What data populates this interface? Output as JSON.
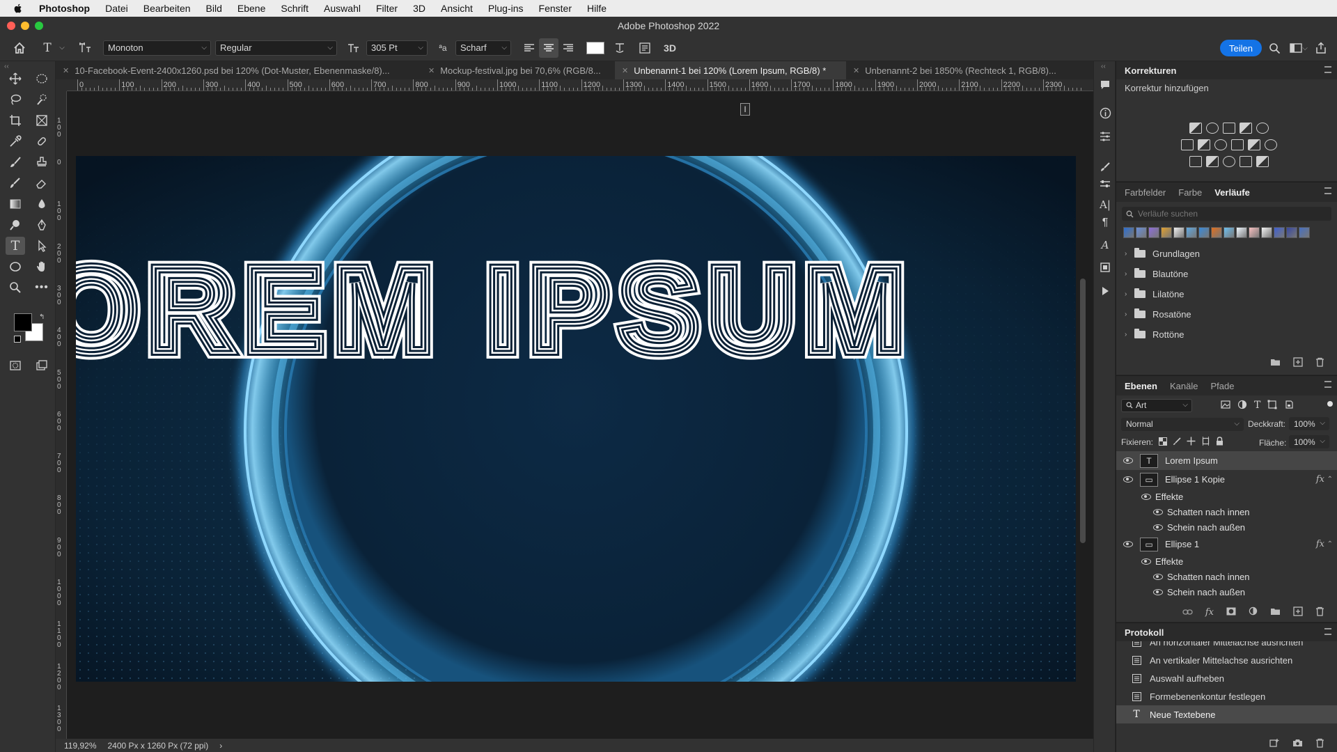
{
  "menubar": {
    "app": "Photoshop",
    "items": [
      "Datei",
      "Bearbeiten",
      "Bild",
      "Ebene",
      "Schrift",
      "Auswahl",
      "Filter",
      "3D",
      "Ansicht",
      "Plug-ins",
      "Fenster",
      "Hilfe"
    ]
  },
  "window": {
    "title": "Adobe Photoshop 2022"
  },
  "options": {
    "font_family": "Monoton",
    "font_style": "Regular",
    "font_size": "305 Pt",
    "aa_label": "ªa",
    "anti_alias": "Scharf",
    "three_d": "3D",
    "share": "Teilen"
  },
  "tabs": [
    {
      "label": "10-Facebook-Event-2400x1260.psd bei 120% (Dot-Muster, Ebenenmaske/8)...",
      "active": false
    },
    {
      "label": "Mockup-festival.jpg bei 70,6% (RGB/8...",
      "active": false
    },
    {
      "label": "Unbenannt-1 bei 120% (Lorem Ipsum, RGB/8) *",
      "active": true
    },
    {
      "label": "Unbenannt-2 bei 1850% (Rechteck 1, RGB/8)...",
      "active": false
    }
  ],
  "ruler": {
    "h_labels": [
      "0",
      "100",
      "200",
      "300",
      "400",
      "500",
      "600",
      "700",
      "800",
      "900",
      "1000",
      "1100",
      "1200",
      "1300",
      "1400",
      "1500",
      "1600",
      "1700",
      "1800",
      "1900",
      "2000",
      "2100",
      "2200",
      "2300"
    ],
    "v_labels": [
      "1 0 0",
      "0",
      "1 0 0",
      "2 0 0",
      "3 0 0",
      "4 0 0",
      "5 0 0",
      "6 0 0",
      "7 0 0",
      "8 0 0",
      "9 0 0",
      "1 0 0 0",
      "1 1 0 0",
      "1 2 0 0",
      "1 3 0 0"
    ]
  },
  "artwork": {
    "text": "LOREM IPSUM"
  },
  "status": {
    "zoom": "119,92%",
    "size": "2400 Px x 1260 Px (72 ppi)",
    "arrow": "›"
  },
  "corrections": {
    "title": "Korrekturen",
    "subtitle": "Korrektur hinzufügen"
  },
  "gradients": {
    "tabs": [
      "Farbfelder",
      "Farbe",
      "Verläufe"
    ],
    "active_tab": "Verläufe",
    "search_placeholder": "Verläufe suchen",
    "swatches": [
      "#2e6fd0",
      "#6a8fd8",
      "#8e6fd8",
      "#e0a030",
      "#f0f0f0",
      "#60a8e0",
      "#3a8ad8",
      "#e07020",
      "#6ec0f0",
      "#f0f8ff",
      "#f8c0c0",
      "#f4f4f4",
      "#4060d0",
      "#3848a0",
      "#4870c0"
    ],
    "folders": [
      "Grundlagen",
      "Blautöne",
      "Lilatöne",
      "Rosatöne",
      "Rottöne"
    ]
  },
  "layers": {
    "tabs": [
      "Ebenen",
      "Kanäle",
      "Pfade"
    ],
    "active_tab": "Ebenen",
    "filter": "Art",
    "blend_mode": "Normal",
    "opacity_label": "Deckkraft:",
    "opacity": "100%",
    "lock_label": "Fixieren:",
    "fill_label": "Fläche:",
    "fill": "100%",
    "rows": [
      {
        "type": "layer",
        "name": "Lorem Ipsum",
        "thumb": "T",
        "fx": "",
        "selected": true
      },
      {
        "type": "layer",
        "name": "Ellipse 1 Kopie",
        "thumb": "▭",
        "fx": "fx",
        "selected": false
      },
      {
        "type": "effects",
        "name": "Effekte"
      },
      {
        "type": "effect",
        "name": "Schatten nach innen"
      },
      {
        "type": "effect",
        "name": "Schein nach außen"
      },
      {
        "type": "layer",
        "name": "Ellipse 1",
        "thumb": "▭",
        "fx": "fx",
        "selected": false
      },
      {
        "type": "effects",
        "name": "Effekte"
      },
      {
        "type": "effect",
        "name": "Schatten nach innen"
      },
      {
        "type": "effect",
        "name": "Schein nach außen"
      }
    ]
  },
  "history": {
    "title": "Protokoll",
    "items": [
      {
        "label": "An horizontaler Mittelachse ausrichten",
        "icon": "doc",
        "selected": false
      },
      {
        "label": "An vertikaler Mittelachse ausrichten",
        "icon": "doc",
        "selected": false
      },
      {
        "label": "Auswahl aufheben",
        "icon": "doc",
        "selected": false
      },
      {
        "label": "Formebenenkontur festlegen",
        "icon": "doc",
        "selected": false
      },
      {
        "label": "Neue Textebene",
        "icon": "T",
        "selected": true
      }
    ]
  },
  "colors": {
    "accent": "#1473e6",
    "panel": "#323232",
    "canvas_bg": "#081a2b",
    "ring": "#7fd0f8"
  }
}
